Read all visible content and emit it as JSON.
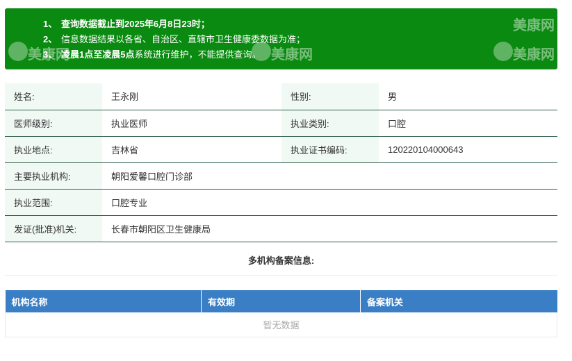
{
  "notice": {
    "lines": [
      {
        "num": "1、",
        "text": "查询数据截止到2025年6月8日23时；"
      },
      {
        "num": "2、",
        "text": "信息数据结果以各省、自治区、直辖市卫生健康委数据为准；"
      },
      {
        "num": "3、",
        "text_bold": "凌晨1点至凌晨5点",
        "text_rest": "系统进行维护，不能提供查询。"
      }
    ]
  },
  "info": {
    "name_label": "姓名:",
    "name_value": "王永刚",
    "gender_label": "性别:",
    "gender_value": "男",
    "level_label": "医师级别:",
    "level_value": "执业医师",
    "category_label": "执业类别:",
    "category_value": "口腔",
    "location_label": "执业地点:",
    "location_value": "吉林省",
    "cert_label": "执业证书编码:",
    "cert_value": "120220104000643",
    "institution_label": "主要执业机构:",
    "institution_value": "朝阳爱馨口腔门诊部",
    "scope_label": "执业范围:",
    "scope_value": "口腔专业",
    "issuer_label": "发证(批准)机关:",
    "issuer_value": "长春市朝阳区卫生健康局"
  },
  "multi": {
    "title": "多机构备案信息:",
    "columns": [
      "机构名称",
      "有效期",
      "备案机关"
    ],
    "empty_text": "暂无数据"
  },
  "watermark": {
    "text": "美康网"
  },
  "colors": {
    "notice_bg": "#0a8a10",
    "header_bg": "#3a7fc5",
    "row_border": "#2b5a45"
  }
}
